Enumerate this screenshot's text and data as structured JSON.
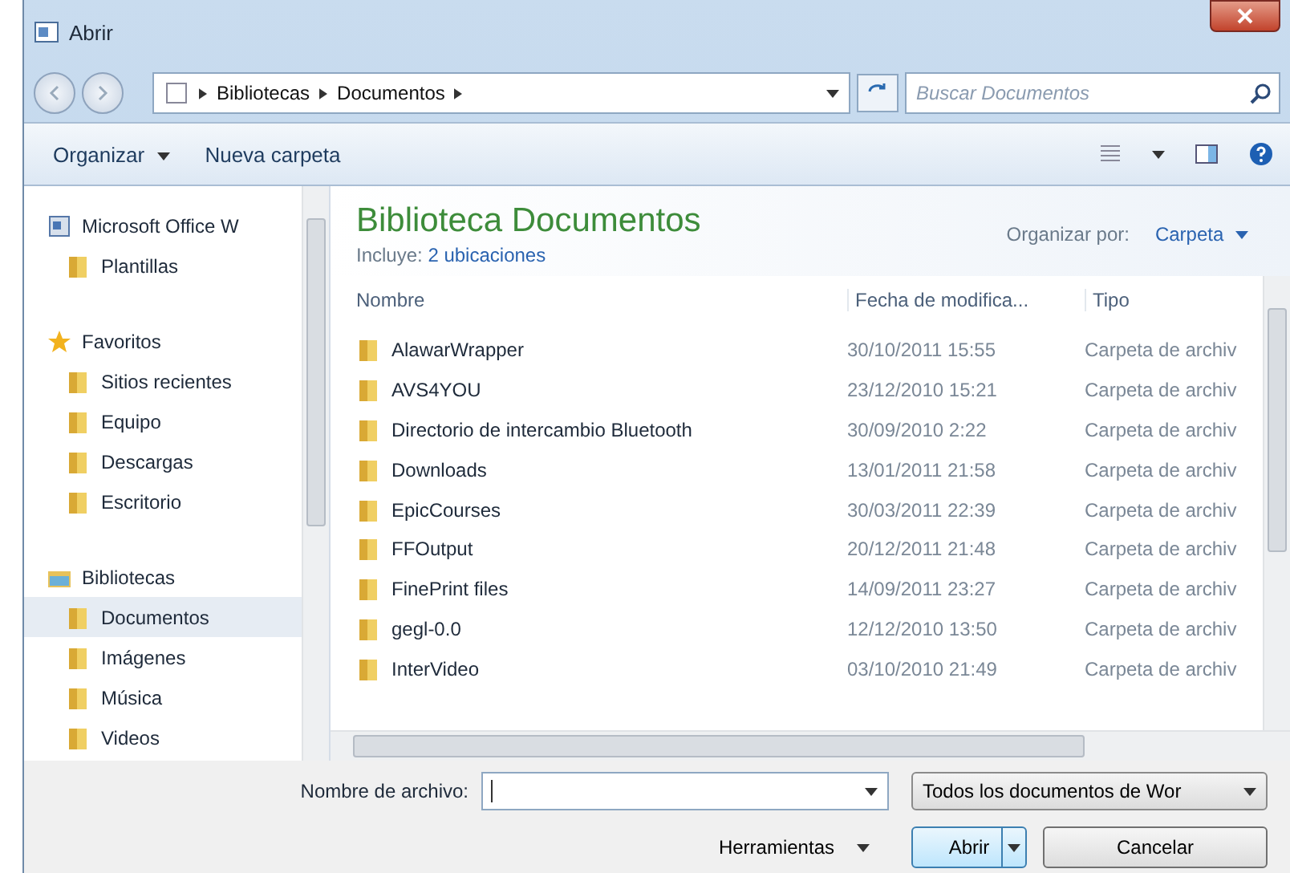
{
  "window": {
    "title": "Abrir"
  },
  "address": {
    "crumbs": [
      "Bibliotecas",
      "Documentos"
    ]
  },
  "search": {
    "placeholder": "Buscar Documentos"
  },
  "toolbar": {
    "organize": "Organizar",
    "new_folder": "Nueva carpeta"
  },
  "sidebar": {
    "groups": [
      {
        "label": "Microsoft Office W",
        "selected": false,
        "children": [
          {
            "label": "Plantillas",
            "selected": false
          }
        ]
      },
      {
        "label": "Favoritos",
        "selected": false,
        "children": [
          {
            "label": "Sitios recientes",
            "selected": false
          },
          {
            "label": "Equipo",
            "selected": false
          },
          {
            "label": "Descargas",
            "selected": false
          },
          {
            "label": "Escritorio",
            "selected": false
          }
        ]
      },
      {
        "label": "Bibliotecas",
        "selected": false,
        "children": [
          {
            "label": "Documentos",
            "selected": true
          },
          {
            "label": "Imágenes",
            "selected": false
          },
          {
            "label": "Música",
            "selected": false
          },
          {
            "label": "Videos",
            "selected": false
          }
        ]
      }
    ]
  },
  "library": {
    "title": "Biblioteca Documentos",
    "includes_label": "Incluye:",
    "includes_link": "2 ubicaciones",
    "arrange_label": "Organizar por:",
    "arrange_value": "Carpeta"
  },
  "table": {
    "columns": [
      "Nombre",
      "Fecha de modifica...",
      "Tipo"
    ],
    "rows": [
      [
        "AlawarWrapper",
        "30/10/2011 15:55",
        "Carpeta de archiv"
      ],
      [
        "AVS4YOU",
        "23/12/2010 15:21",
        "Carpeta de archiv"
      ],
      [
        "Directorio de intercambio Bluetooth",
        "30/09/2010 2:22",
        "Carpeta de archiv"
      ],
      [
        "Downloads",
        "13/01/2011 21:58",
        "Carpeta de archiv"
      ],
      [
        "EpicCourses",
        "30/03/2011 22:39",
        "Carpeta de archiv"
      ],
      [
        "FFOutput",
        "20/12/2011 21:48",
        "Carpeta de archiv"
      ],
      [
        "FinePrint files",
        "14/09/2011 23:27",
        "Carpeta de archiv"
      ],
      [
        "gegl-0.0",
        "12/12/2010 13:50",
        "Carpeta de archiv"
      ],
      [
        "InterVideo",
        "03/10/2010 21:49",
        "Carpeta de archiv"
      ]
    ]
  },
  "filename": {
    "label": "Nombre de archivo:"
  },
  "filetype": {
    "value": "Todos los documentos de Wor"
  },
  "buttons": {
    "tools": "Herramientas",
    "open": "Abrir",
    "cancel": "Cancelar"
  }
}
